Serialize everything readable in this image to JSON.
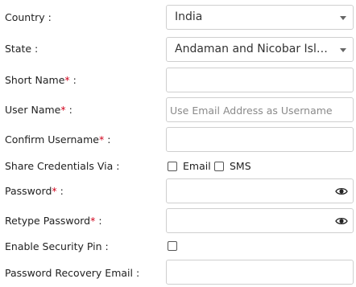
{
  "form": {
    "country": {
      "label": "Country :",
      "value": "India"
    },
    "state": {
      "label": "State :",
      "value": "Andaman and Nicobar Isla..."
    },
    "short_name": {
      "label": "Short Name",
      "required": "*",
      "suffix": " :",
      "value": ""
    },
    "user_name": {
      "label": "User Name",
      "required": "*",
      "suffix": " :",
      "placeholder": "Use Email Address as Username",
      "value": ""
    },
    "confirm_username": {
      "label": "Confirm Username",
      "required": "*",
      "suffix": " :",
      "value": ""
    },
    "share_credentials": {
      "label": "Share Credentials Via :",
      "options": [
        {
          "label": "Email",
          "checked": false
        },
        {
          "label": "SMS",
          "checked": false
        }
      ]
    },
    "password": {
      "label": "Password",
      "required": "*",
      "suffix": " :",
      "value": "",
      "icon": "eye-icon"
    },
    "retype_password": {
      "label": "Retype Password",
      "required": "*",
      "suffix": " :",
      "value": "",
      "icon": "eye-icon"
    },
    "enable_security_pin": {
      "label": "Enable Security Pin :",
      "checked": false
    },
    "password_recovery_email": {
      "label": "Password Recovery Email :",
      "value": ""
    }
  },
  "colors": {
    "required_marker": "#d0021b",
    "border": "#cfcfcf",
    "placeholder": "#8a8a8a"
  }
}
